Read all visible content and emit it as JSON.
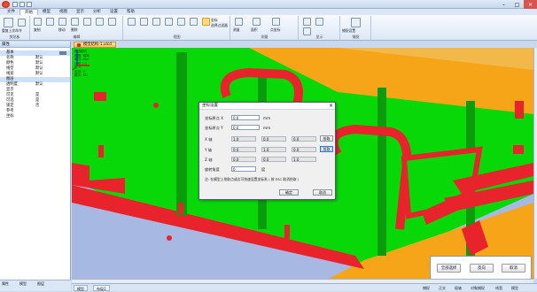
{
  "titlebar": {
    "title": "",
    "quick_access": [
      "save-icon",
      "undo-icon",
      "redo-icon"
    ]
  },
  "tabs": [
    "文件",
    "开始",
    "模型",
    "视图",
    "显示",
    "分析",
    "设置",
    "帮助"
  ],
  "active_tab": "开始",
  "ribbon": {
    "groups": [
      "剪贴板",
      "编辑",
      "视图",
      "测量",
      "显示",
      "捕捉"
    ],
    "labels": [
      "重复上次命令",
      "选择",
      "复制",
      "移动",
      "删除",
      "坐标",
      "选择过滤器",
      "测量",
      "面积",
      "点坐标",
      "捕捉设置",
      "快捷键设置"
    ]
  },
  "doc_tab": "模型结构-1.ulcd",
  "left_panel": {
    "header": "属性",
    "rows": [
      {
        "k": "基本",
        "v": ""
      },
      {
        "k": "名称",
        "v": "默认"
      },
      {
        "k": "颜色",
        "v": "默认"
      },
      {
        "k": "线型",
        "v": "默认"
      },
      {
        "k": "线宽",
        "v": "默认"
      },
      {
        "k": "图层",
        "v": ""
      },
      {
        "k": "透明度",
        "v": "默认"
      },
      {
        "k": "显示",
        "v": ""
      },
      {
        "k": "可见",
        "v": "是"
      },
      {
        "k": "可选",
        "v": "是"
      },
      {
        "k": "锁定",
        "v": "否"
      },
      {
        "k": "参考",
        "v": ""
      },
      {
        "k": "坐标",
        "v": ""
      }
    ],
    "tabs": [
      "属性",
      "模型",
      "图层"
    ]
  },
  "viewport_overlay": [
    "框选模式",
    "视图: 轴测",
    "单位: mm",
    "比例 1:1",
    "层 0",
    "选择: 0",
    "模式: 3D"
  ],
  "dialog": {
    "title": "坐标设置",
    "rows": [
      {
        "label": "坐标原点 X",
        "value": "0.0",
        "unit": "mm"
      },
      {
        "label": "坐标原点 Y",
        "value": "0.0",
        "unit": "mm"
      }
    ],
    "vec_rows": [
      {
        "label": "X 轴",
        "a": "1.0",
        "b": "0.0",
        "c": "0.0",
        "btn": "拾取"
      },
      {
        "label": "Y 轴",
        "a": "0.0",
        "b": "1.0",
        "c": "0.0",
        "btn": "拾取"
      },
      {
        "label": "Z 轴",
        "a": "0.0",
        "b": "0.0",
        "c": "1.0"
      }
    ],
    "angle_label": "旋转角度",
    "angle_value": "0",
    "angle_unit": "度",
    "note": "注: 在模型上拾取点或边可快速设置坐标系 ( 按 ESC 取消拾取 )",
    "ok": "确定",
    "cancel": "取消"
  },
  "select_panel": {
    "buttons": [
      "全部选择",
      "反向",
      "取消"
    ]
  },
  "statusbar": {
    "tabs": [
      "模型",
      "布局1"
    ],
    "items": [
      "捕捉",
      "正交",
      "极轴",
      "对象捕捉",
      "线宽",
      "模型"
    ]
  },
  "colors": {
    "green": "#08d808",
    "red": "#e8232b",
    "orange": "#f7a518",
    "blue_floor": "#a7b8e3",
    "accent": "#2f7fd6"
  }
}
